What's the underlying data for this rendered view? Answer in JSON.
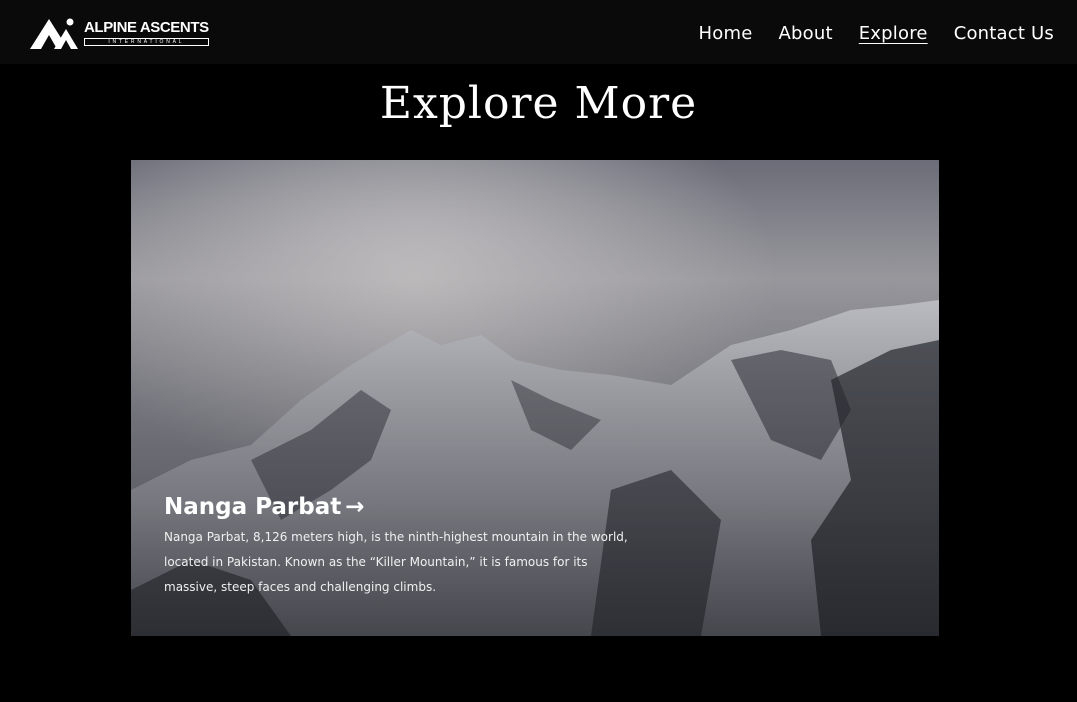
{
  "navbar": {
    "logo": {
      "name": "ALPINE ASCENTS",
      "tagline": "INTERNATIONAL"
    },
    "links": [
      {
        "label": "Home",
        "active": false
      },
      {
        "label": "About",
        "active": false
      },
      {
        "label": "Explore",
        "active": true
      },
      {
        "label": "Contact Us",
        "active": false
      }
    ]
  },
  "main": {
    "title": "Explore More",
    "card": {
      "title": "Nanga Parbat",
      "arrow": "→",
      "description": "Nanga Parbat, 8,126 meters high, is the ninth-highest mountain in the world, located in Pakistan. Known as the “Killer Mountain,” it is famous for its massive, steep faces and challenging climbs."
    }
  },
  "colors": {
    "background": "#000000",
    "navbar": "#0a0a0a",
    "text": "#ffffff"
  }
}
